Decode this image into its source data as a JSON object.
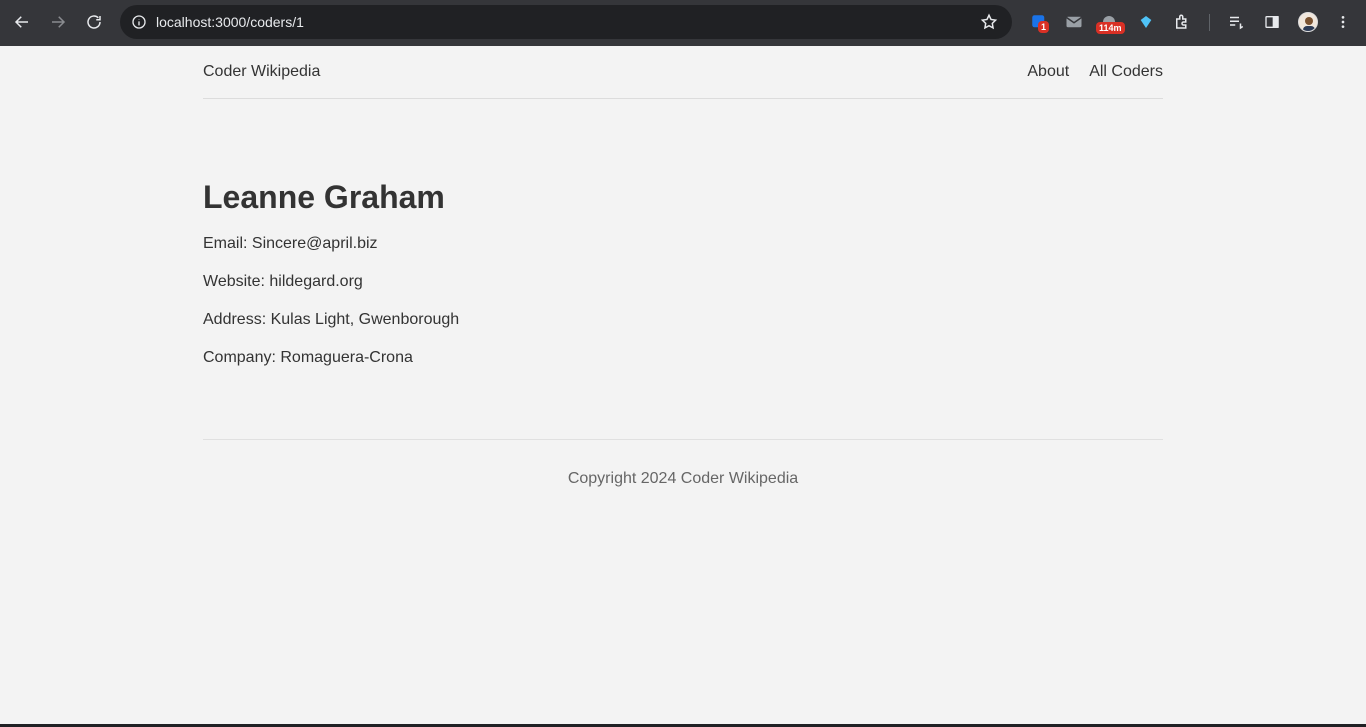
{
  "browser": {
    "url_host": "localhost",
    "url_rest": ":3000/coders/1",
    "extension_badge_1": "1",
    "extension_badge_2": "114m"
  },
  "site": {
    "brand": "Coder Wikipedia",
    "nav": [
      {
        "label": "About"
      },
      {
        "label": "All Coders"
      }
    ]
  },
  "coder": {
    "name": "Leanne Graham",
    "fields": [
      {
        "text": "Email: Sincere@april.biz"
      },
      {
        "text": "Website: hildegard.org"
      },
      {
        "text": "Address: Kulas Light, Gwenborough"
      },
      {
        "text": "Company: Romaguera-Crona"
      }
    ]
  },
  "footer": {
    "copyright": "Copyright 2024 Coder Wikipedia"
  },
  "colors": {
    "chrome_bg": "#35363a",
    "omnibox_bg": "#202124",
    "page_bg": "#f3f3f3",
    "text": "#333333",
    "footer_text": "#666666",
    "badge_red": "#d93025"
  }
}
